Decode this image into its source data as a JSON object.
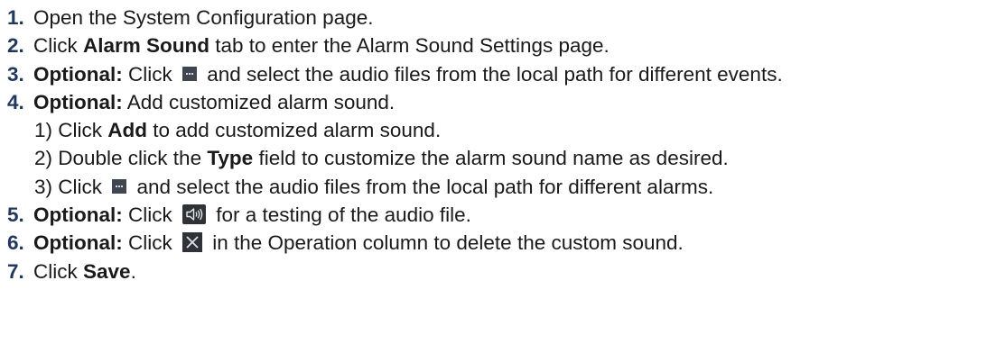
{
  "steps": [
    {
      "num": "1.",
      "text": "Open the System Configuration page."
    },
    {
      "num": "2.",
      "pre": "Click ",
      "bold": "Alarm Sound",
      "post": " tab to enter the Alarm Sound Settings page."
    },
    {
      "num": "3.",
      "label": "Optional:",
      "pre": " Click ",
      "icon": "more-icon",
      "post": " and select the audio files from the local path for different events."
    },
    {
      "num": "4.",
      "label": "Optional:",
      "post": " Add customized alarm sound.",
      "substeps": [
        {
          "pre": "1) Click ",
          "bold": "Add",
          "post": " to add customized alarm sound."
        },
        {
          "pre": "2) Double click the ",
          "bold": "Type",
          "post": " field to customize the alarm sound name as desired."
        },
        {
          "pre": "3) Click ",
          "icon": "more-icon",
          "post": " and select the audio files from the local path for different alarms."
        }
      ]
    },
    {
      "num": "5.",
      "label": "Optional:",
      "pre": " Click ",
      "icon": "speaker-icon",
      "post": " for a testing of the audio file."
    },
    {
      "num": "6.",
      "label": "Optional:",
      "pre": " Click ",
      "icon": "close-icon",
      "post": " in the Operation column to delete the custom sound."
    },
    {
      "num": "7.",
      "pre": "Click ",
      "bold": "Save",
      "post": "."
    }
  ]
}
